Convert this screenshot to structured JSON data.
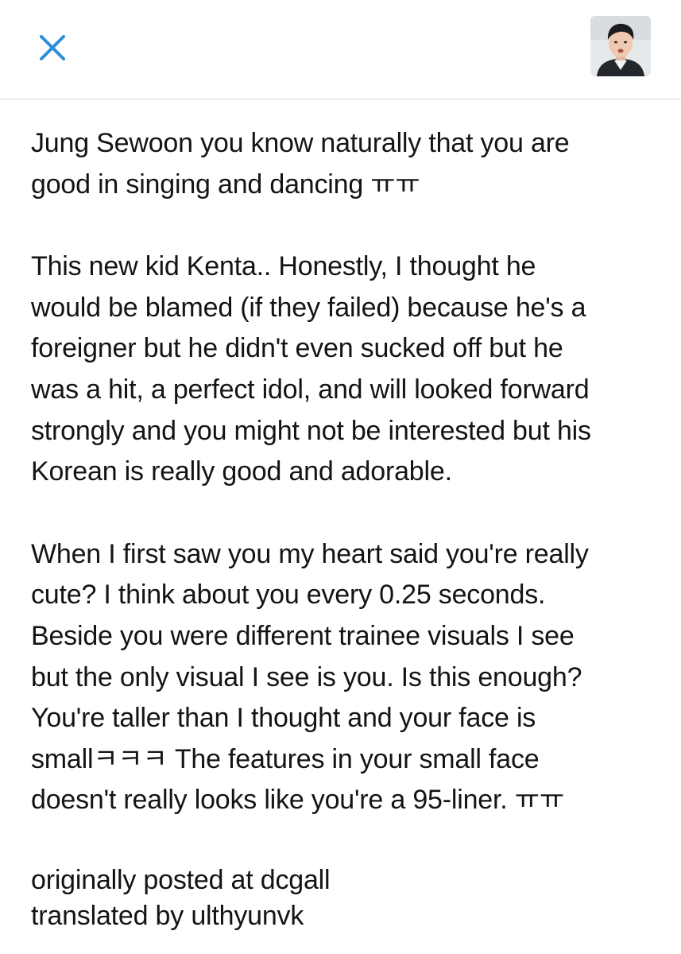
{
  "header": {
    "close_icon": "close-icon",
    "accent_color": "#2b8fd6",
    "avatar": "profile-avatar"
  },
  "post": {
    "paragraphs": [
      "Jung Sewoon you know naturally that you are\ngood in singing and dancing ㅠㅠ",
      "This new kid Kenta.. Honestly, I thought he\nwould be blamed (if they failed) because he's a\nforeigner but he didn't even sucked off but he\nwas a hit, a perfect idol, and will looked forward\nstrongly and you might not be interested but his\nKorean is really good and adorable.",
      "When I first saw you my heart said you're really\ncute? I think about you every 0.25 seconds.\nBeside you were different trainee visuals I see\nbut the only visual I see is you. Is this enough?\nYou're taller than I thought and your face is\nsmallㅋㅋㅋ The features in your small face\ndoesn't really looks like you're a 95-liner. ㅠㅠ"
    ],
    "credits": {
      "source": "originally posted at dcgall",
      "translator": "translated by ulthyunvk"
    }
  }
}
